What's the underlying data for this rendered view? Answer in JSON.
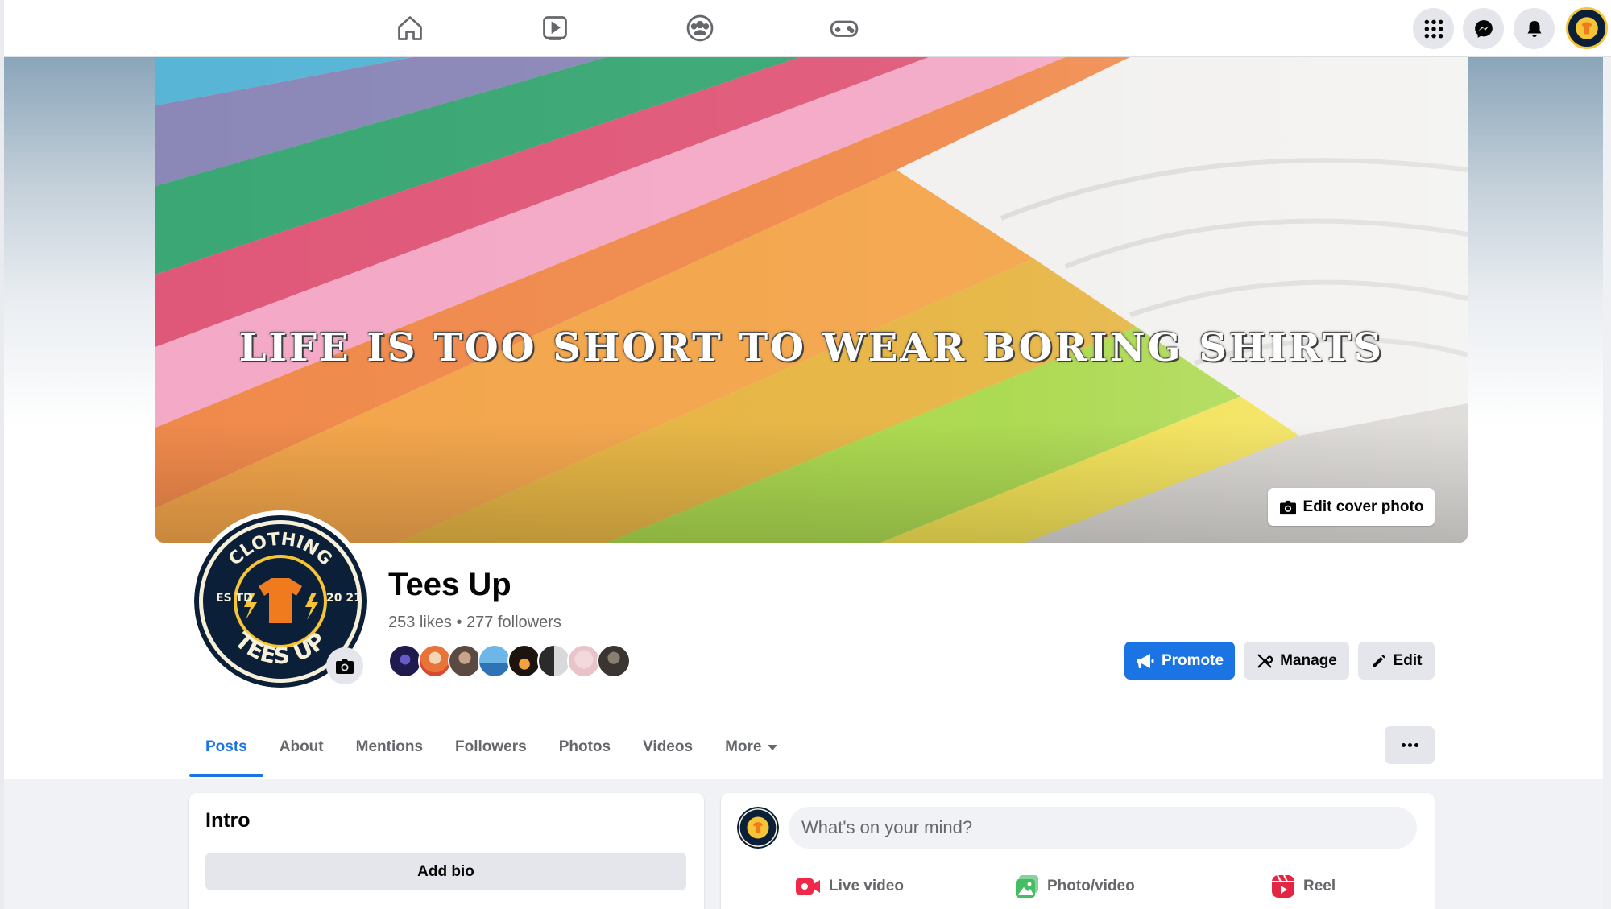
{
  "topnav": {
    "tabs": [
      {
        "name": "home-icon"
      },
      {
        "name": "video-icon"
      },
      {
        "name": "groups-icon"
      },
      {
        "name": "gaming-icon"
      }
    ],
    "right_icons": [
      "menu-grid-icon",
      "messenger-icon",
      "notifications-icon"
    ],
    "avatar_text": "CLOTHING TEES UP"
  },
  "cover": {
    "tagline": "LIFE IS TOO SHORT TO WEAR BORING SHIRTS",
    "edit_label": "Edit cover photo"
  },
  "page": {
    "avatar_text_top": "CLOTHING",
    "avatar_text_bottom": "TEES UP",
    "avatar_est": "ES TD",
    "avatar_year": "20 21",
    "name": "Tees Up",
    "stats": "253 likes • 277 followers",
    "follower_faces": 8
  },
  "actions": {
    "promote": "Promote",
    "manage": "Manage",
    "edit": "Edit"
  },
  "tabs": [
    {
      "label": "Posts",
      "active": true
    },
    {
      "label": "About"
    },
    {
      "label": "Mentions"
    },
    {
      "label": "Followers"
    },
    {
      "label": "Photos"
    },
    {
      "label": "Videos"
    },
    {
      "label": "More"
    }
  ],
  "intro": {
    "title": "Intro",
    "add_bio": "Add bio"
  },
  "composer": {
    "placeholder": "What's on your mind?",
    "actions": [
      {
        "label": "Live video",
        "color": "#f02849"
      },
      {
        "label": "Photo/video",
        "color": "#45bd62"
      },
      {
        "label": "Reel",
        "color": "#e42645"
      }
    ]
  },
  "colors": {
    "accent": "#1b74e4",
    "logo_navy": "#0b2038",
    "logo_gold": "#f5c437",
    "logo_orange": "#f07b1e"
  }
}
